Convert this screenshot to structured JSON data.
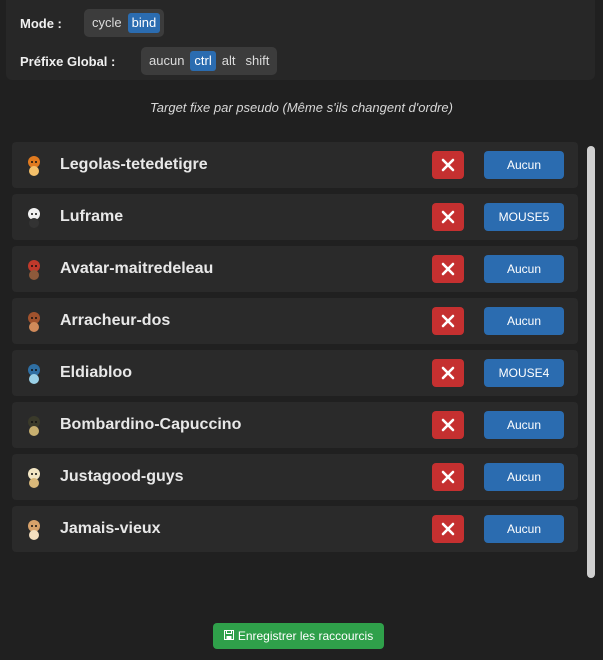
{
  "mode": {
    "label": "Mode :",
    "options": [
      "cycle",
      "bind"
    ],
    "selected": "bind"
  },
  "prefix": {
    "label": "Préfixe Global :",
    "options": [
      "aucun",
      "ctrl",
      "alt",
      "shift"
    ],
    "selected": "ctrl"
  },
  "subtitle": "Target fixe par pseudo (Même s'ils changent d'ordre)",
  "characters": [
    {
      "name": "Legolas-tetedetigre",
      "bind": "Aucun",
      "icon": "orange-fox-character-icon"
    },
    {
      "name": "Luframe",
      "bind": "MOUSE5",
      "icon": "skull-character-icon"
    },
    {
      "name": "Avatar-maitredeleau",
      "bind": "Aucun",
      "icon": "red-hat-character-icon"
    },
    {
      "name": "Arracheur-dos",
      "bind": "Aucun",
      "icon": "brown-character-icon"
    },
    {
      "name": "Eldiabloo",
      "bind": "MOUSE4",
      "icon": "blue-hood-character-icon"
    },
    {
      "name": "Bombardino-Capuccino",
      "bind": "Aucun",
      "icon": "dark-character-icon"
    },
    {
      "name": "Justagood-guys",
      "bind": "Aucun",
      "icon": "cream-character-icon"
    },
    {
      "name": "Jamais-vieux",
      "bind": "Aucun",
      "icon": "tan-character-icon"
    }
  ],
  "save_label": "Enregistrer les raccourcis",
  "colors": {
    "accent": "#2b6cb0",
    "danger": "#c53030",
    "success": "#2fa04a"
  }
}
